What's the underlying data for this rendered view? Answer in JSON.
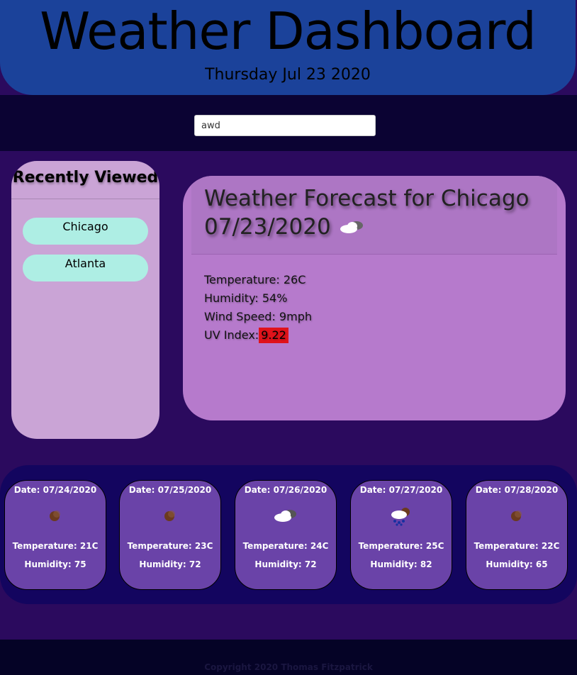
{
  "header": {
    "title": "Weather Dashboard",
    "date": "Thursday Jul 23 2020"
  },
  "search": {
    "value": "awd"
  },
  "recent": {
    "title": "Recently Viewed",
    "cities": [
      {
        "label": "Chicago"
      },
      {
        "label": "Atlanta"
      }
    ]
  },
  "current": {
    "title": "Weather Forecast for Chicago 07/23/2020",
    "icon": "cloudy-icon",
    "temperature": "Temperature: 26C",
    "humidity": "Humidity: 54%",
    "wind": "Wind Speed: 9mph",
    "uv_label": "UV Index:",
    "uv_value": "9.22",
    "uv_color": "#e0131b"
  },
  "forecast": [
    {
      "date": "Date: 07/24/2020",
      "icon": "clear-night-icon",
      "temp": "Temperature: 21C",
      "humidity": "Humidity: 75"
    },
    {
      "date": "Date: 07/25/2020",
      "icon": "clear-night-icon",
      "temp": "Temperature: 23C",
      "humidity": "Humidity: 72"
    },
    {
      "date": "Date: 07/26/2020",
      "icon": "cloudy-icon",
      "temp": "Temperature: 24C",
      "humidity": "Humidity: 72"
    },
    {
      "date": "Date: 07/27/2020",
      "icon": "rain-night-icon",
      "temp": "Temperature: 25C",
      "humidity": "Humidity: 82"
    },
    {
      "date": "Date: 07/28/2020",
      "icon": "clear-night-icon",
      "temp": "Temperature: 22C",
      "humidity": "Humidity: 65"
    }
  ],
  "footer": {
    "copyright": "Copyright 2020 Thomas Fitzpatrick"
  }
}
